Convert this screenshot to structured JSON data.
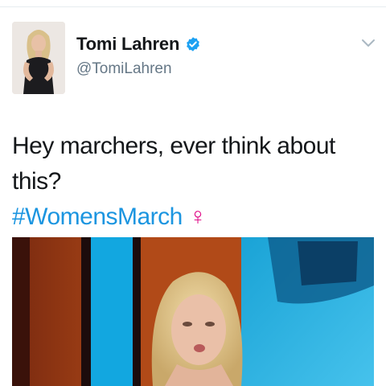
{
  "tweet": {
    "display_name": "Tomi Lahren",
    "handle": "@TomiLahren",
    "text": "Hey marchers, ever think about this?",
    "hashtag": "#WomensMarch",
    "emoji": "♀"
  },
  "icons": {
    "verified": "verified-badge-icon",
    "menu": "chevron-down-icon"
  },
  "colors": {
    "link": "#1b95e0",
    "verified": "#1da1f2",
    "emoji": "#e0118a",
    "secondary_text": "#657786",
    "primary_text": "#14171a"
  }
}
